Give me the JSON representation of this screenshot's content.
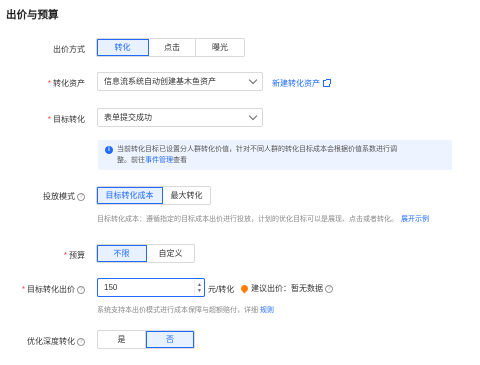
{
  "section_title": "出价与预算",
  "bid_method": {
    "label": "出价方式",
    "options": [
      "转化",
      "点击",
      "曝光"
    ],
    "selected": "转化"
  },
  "conversion_asset": {
    "label": "转化资产",
    "value": "信息流系统自动创建基木鱼资产",
    "new_link": "新建转化资产"
  },
  "target_conversion": {
    "label": "目标转化",
    "value": "表单提交成功"
  },
  "info_notice": {
    "line1": "当前转化目标已设置分人群转化价值，针对不同人群的转化目标成本会根据价值系数进行调",
    "line2_prefix": "整。前往",
    "line2_link": "事件管理",
    "line2_suffix": "查看"
  },
  "delivery_mode": {
    "label": "投放模式",
    "options": [
      "目标转化成本",
      "最大转化"
    ],
    "selected": "目标转化成本",
    "hint": "目标转化成本：遵循指定的目标成本出价进行投放，计划的优化目标可以是展现、点击或者转化。",
    "expand_link": "展开示例"
  },
  "budget": {
    "label": "预算",
    "options": [
      "不限",
      "自定义"
    ],
    "selected": "不限"
  },
  "target_bid": {
    "label": "目标转化出价",
    "value": "150",
    "unit": "元/转化",
    "suggest_label": "建议出价：暂无数据",
    "hint": "系统支持本出价模式进行成本保障与超额赔付，详细",
    "rules_link": "规则"
  },
  "deep_conversion": {
    "label": "优化深度转化",
    "options": [
      "是",
      "否"
    ],
    "selected": "否"
  },
  "colors": {
    "primary": "#1f6bff",
    "required": "#f53f3f",
    "warning": "#ff7d00"
  },
  "icons": [
    "help-icon",
    "info-icon",
    "location-pin-icon",
    "external-link-icon",
    "chevron-down-icon"
  ]
}
